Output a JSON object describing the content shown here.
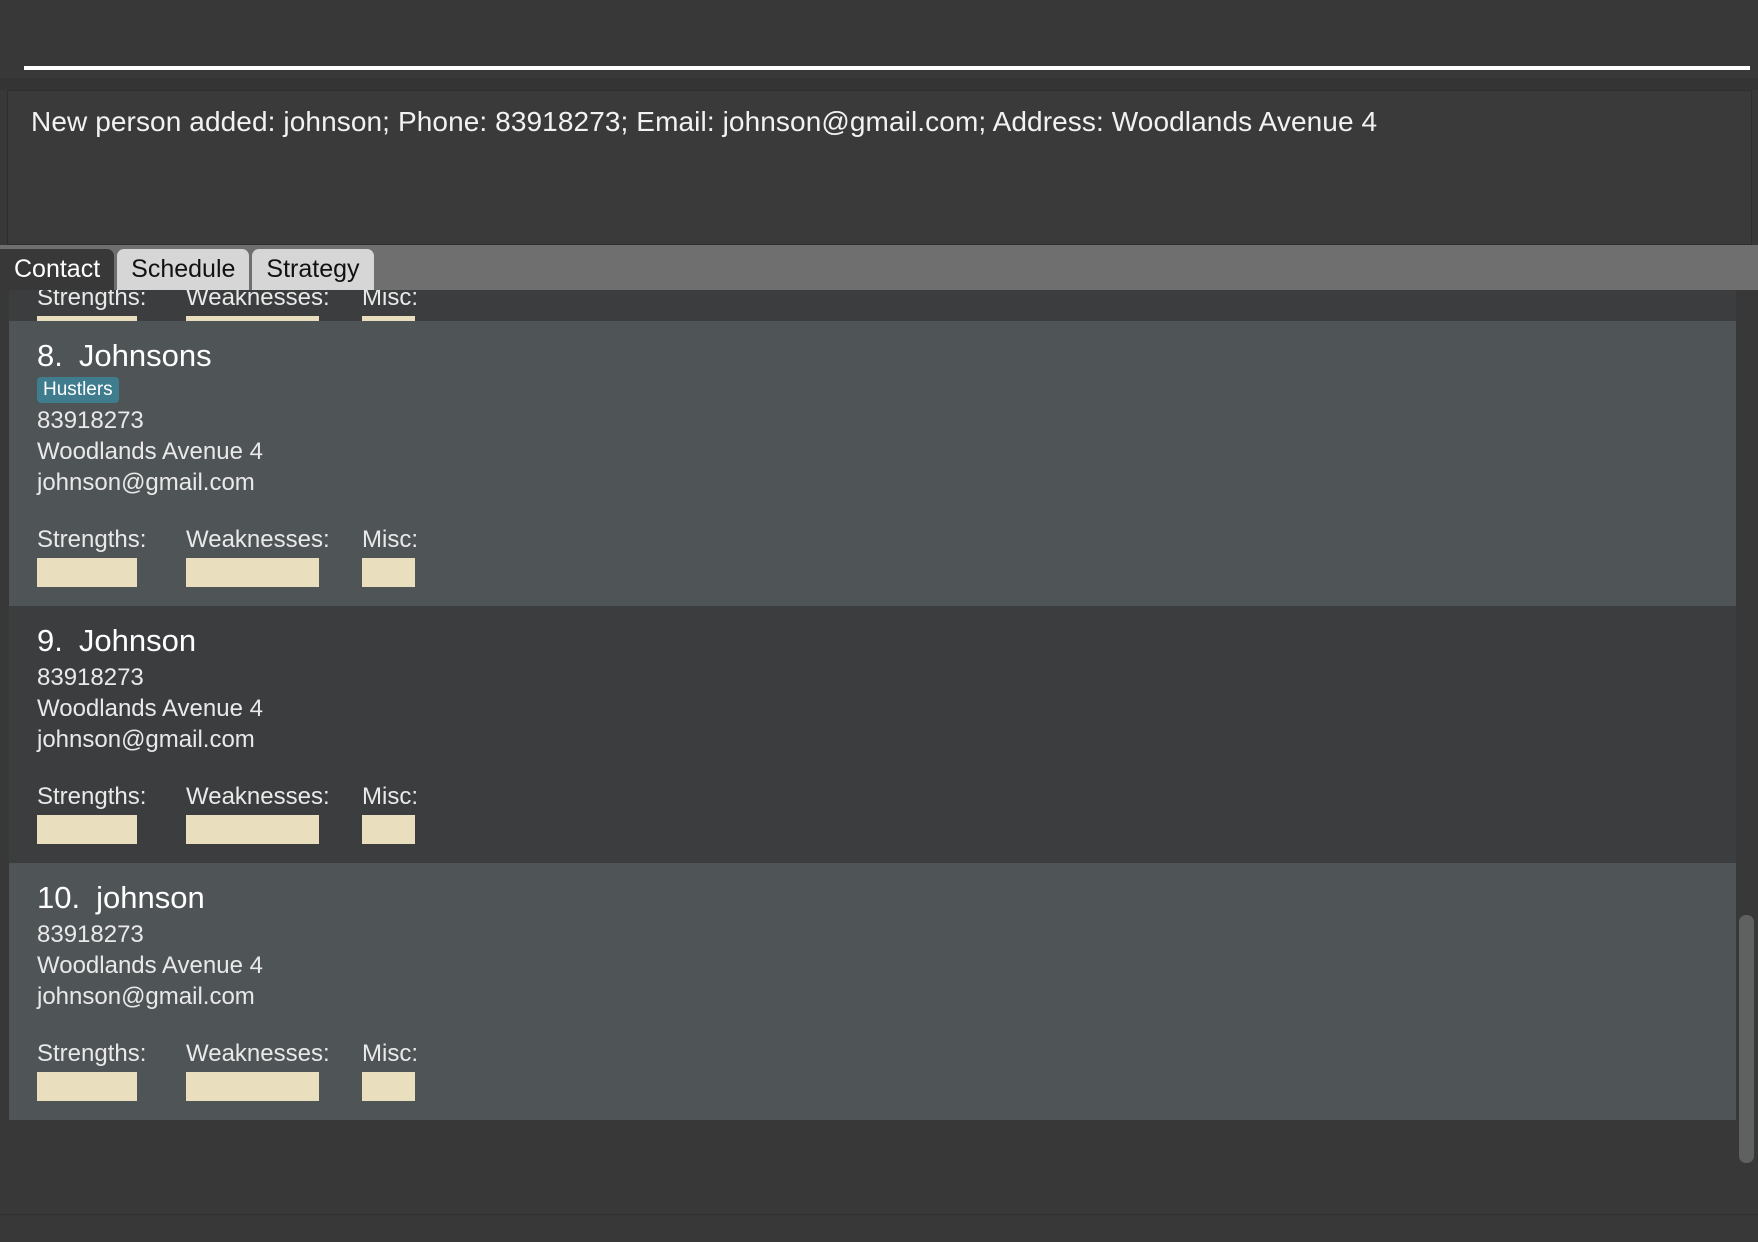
{
  "command": {
    "input_value": "",
    "placeholder": ""
  },
  "result": {
    "message": "New person added: johnson; Phone: 83918273; Email: johnson@gmail.com; Address: Woodlands Avenue 4"
  },
  "tabs": [
    {
      "label": "Contact",
      "active": true
    },
    {
      "label": "Schedule",
      "active": false
    },
    {
      "label": "Strategy",
      "active": false
    }
  ],
  "field_labels": {
    "strengths": "Strengths:",
    "weaknesses": "Weaknesses:",
    "misc": "Misc:"
  },
  "contacts": [
    {
      "index": "8.",
      "name": "Johnsons",
      "tag": "Hustlers",
      "phone": "83918273",
      "address": "Woodlands Avenue 4",
      "email": "johnson@gmail.com",
      "strengths_value": "",
      "weaknesses_value": "",
      "misc_value": ""
    },
    {
      "index": "9.",
      "name": "Johnson",
      "tag": "",
      "phone": "83918273",
      "address": "Woodlands Avenue 4",
      "email": "johnson@gmail.com",
      "strengths_value": "",
      "weaknesses_value": "",
      "misc_value": ""
    },
    {
      "index": "10.",
      "name": "johnson",
      "tag": "",
      "phone": "83918273",
      "address": "Woodlands Avenue 4",
      "email": "johnson@gmail.com",
      "strengths_value": "",
      "weaknesses_value": "",
      "misc_value": ""
    }
  ],
  "colors": {
    "window_background": "#383838",
    "row_odd": "#4f5457",
    "row_even": "#3b3d3e",
    "tag_background": "#3e7c8e",
    "input_background": "#e9dfbe",
    "tabbar_background": "#6f6f6f",
    "tab_inactive": "#d6d6d6",
    "text_primary": "#ffffff"
  }
}
